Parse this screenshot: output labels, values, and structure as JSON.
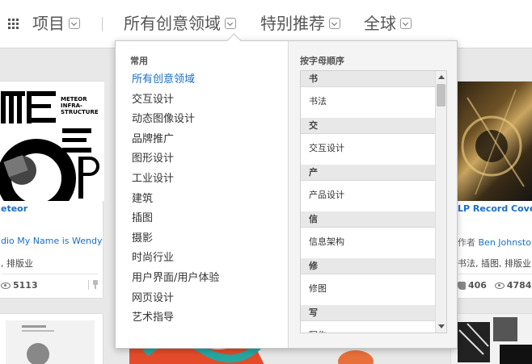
{
  "nav": {
    "projects": "项目",
    "fields": "所有创意领域",
    "featured": "特别推荐",
    "region": "全球"
  },
  "dropdown": {
    "common_head": "常用",
    "alpha_head": "按字母顺序",
    "common_items": [
      "所有创意领域",
      "交互设计",
      "动态图像设计",
      "品牌推广",
      "图形设计",
      "工业设计",
      "建筑",
      "插图",
      "摄影",
      "时尚行业",
      "用户界面/用户体验",
      "网页设计",
      "艺术指导"
    ],
    "alpha_groups": [
      {
        "letter": "书",
        "item": "书法"
      },
      {
        "letter": "交",
        "item": "交互设计"
      },
      {
        "letter": "产",
        "item": "产品设计"
      },
      {
        "letter": "信",
        "item": "信息架构"
      },
      {
        "letter": "修",
        "item": "修图"
      },
      {
        "letter": "写",
        "item": "写作"
      }
    ]
  },
  "cards": {
    "left": {
      "title": "eteor",
      "owner": "dio My Name is Wendy",
      "fields": ", 排版业",
      "views": "5113"
    },
    "right": {
      "title": "LP Record Cover",
      "owner_prefix": "作者",
      "owner": "Ben Johnston",
      "fields": "书法, 插图, 排版业",
      "likes": "406",
      "views": "4784"
    }
  },
  "poster": {
    "line1": "METEOR",
    "line2": "INFRA-",
    "line3": "STRUCTURE"
  }
}
